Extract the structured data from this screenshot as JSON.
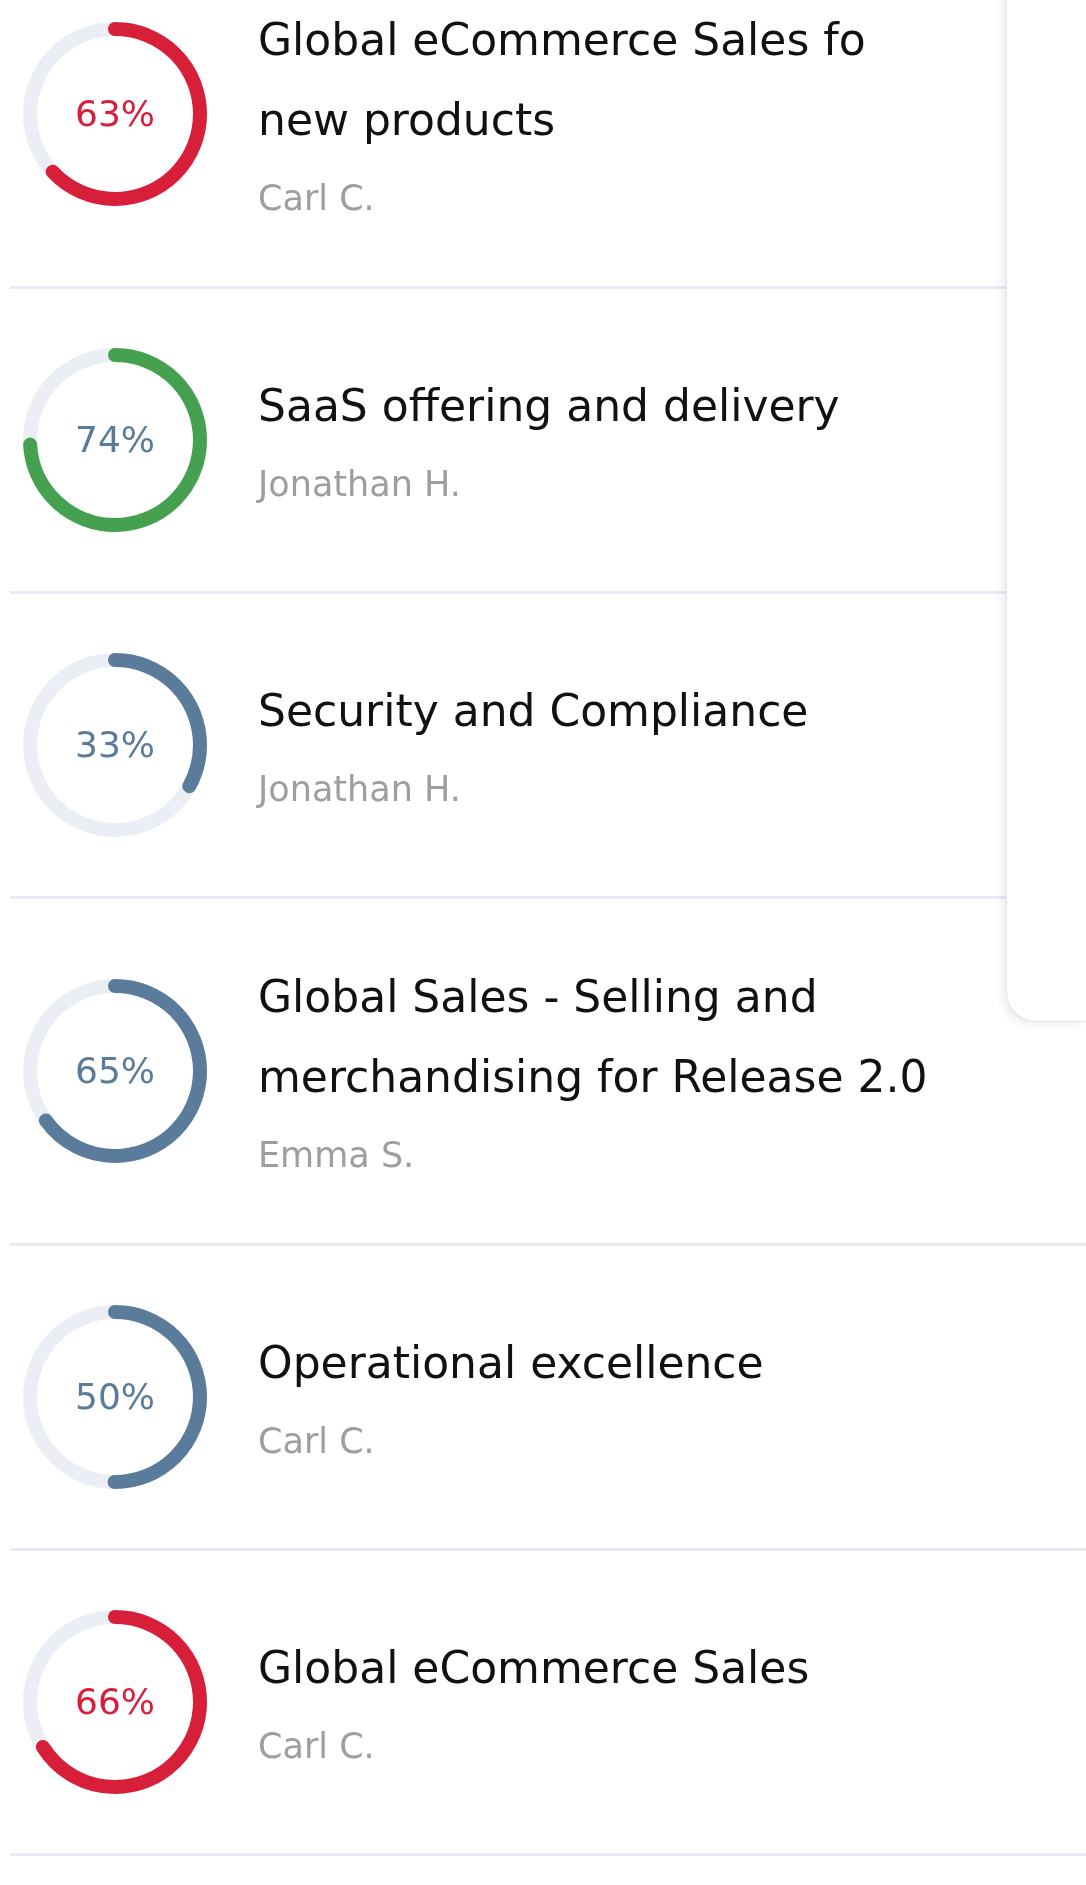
{
  "goals": [
    {
      "title_lines": [
        "Global eCommerce Sales fo",
        "new products"
      ],
      "owner": "Carl C.",
      "percent": "63%",
      "level": 0.63,
      "color": "#d71f3a",
      "kind": "alert"
    },
    {
      "title_lines": [
        "SaaS offering and delivery"
      ],
      "owner": "Jonathan H.",
      "percent": "74%",
      "level": 0.74,
      "color": "#45a04f",
      "kind": "normal"
    },
    {
      "title_lines": [
        "Security and Compliance"
      ],
      "owner": "Jonathan H.",
      "percent": "33%",
      "level": 0.33,
      "color": "#5a7b99",
      "kind": "normal"
    },
    {
      "title_lines": [
        "Global Sales - Selling and",
        "merchandising for Release 2.0"
      ],
      "owner": "Emma S.",
      "percent": "65%",
      "level": 0.65,
      "color": "#5a7b99",
      "kind": "normal"
    },
    {
      "title_lines": [
        "Operational excellence"
      ],
      "owner": "Carl C.",
      "percent": "50%",
      "level": 0.5,
      "color": "#5a7b99",
      "kind": "normal"
    },
    {
      "title_lines": [
        "Global eCommerce Sales"
      ],
      "owner": "Carl C.",
      "percent": "66%",
      "level": 0.66,
      "color": "#d71f3a",
      "kind": "alert"
    }
  ]
}
